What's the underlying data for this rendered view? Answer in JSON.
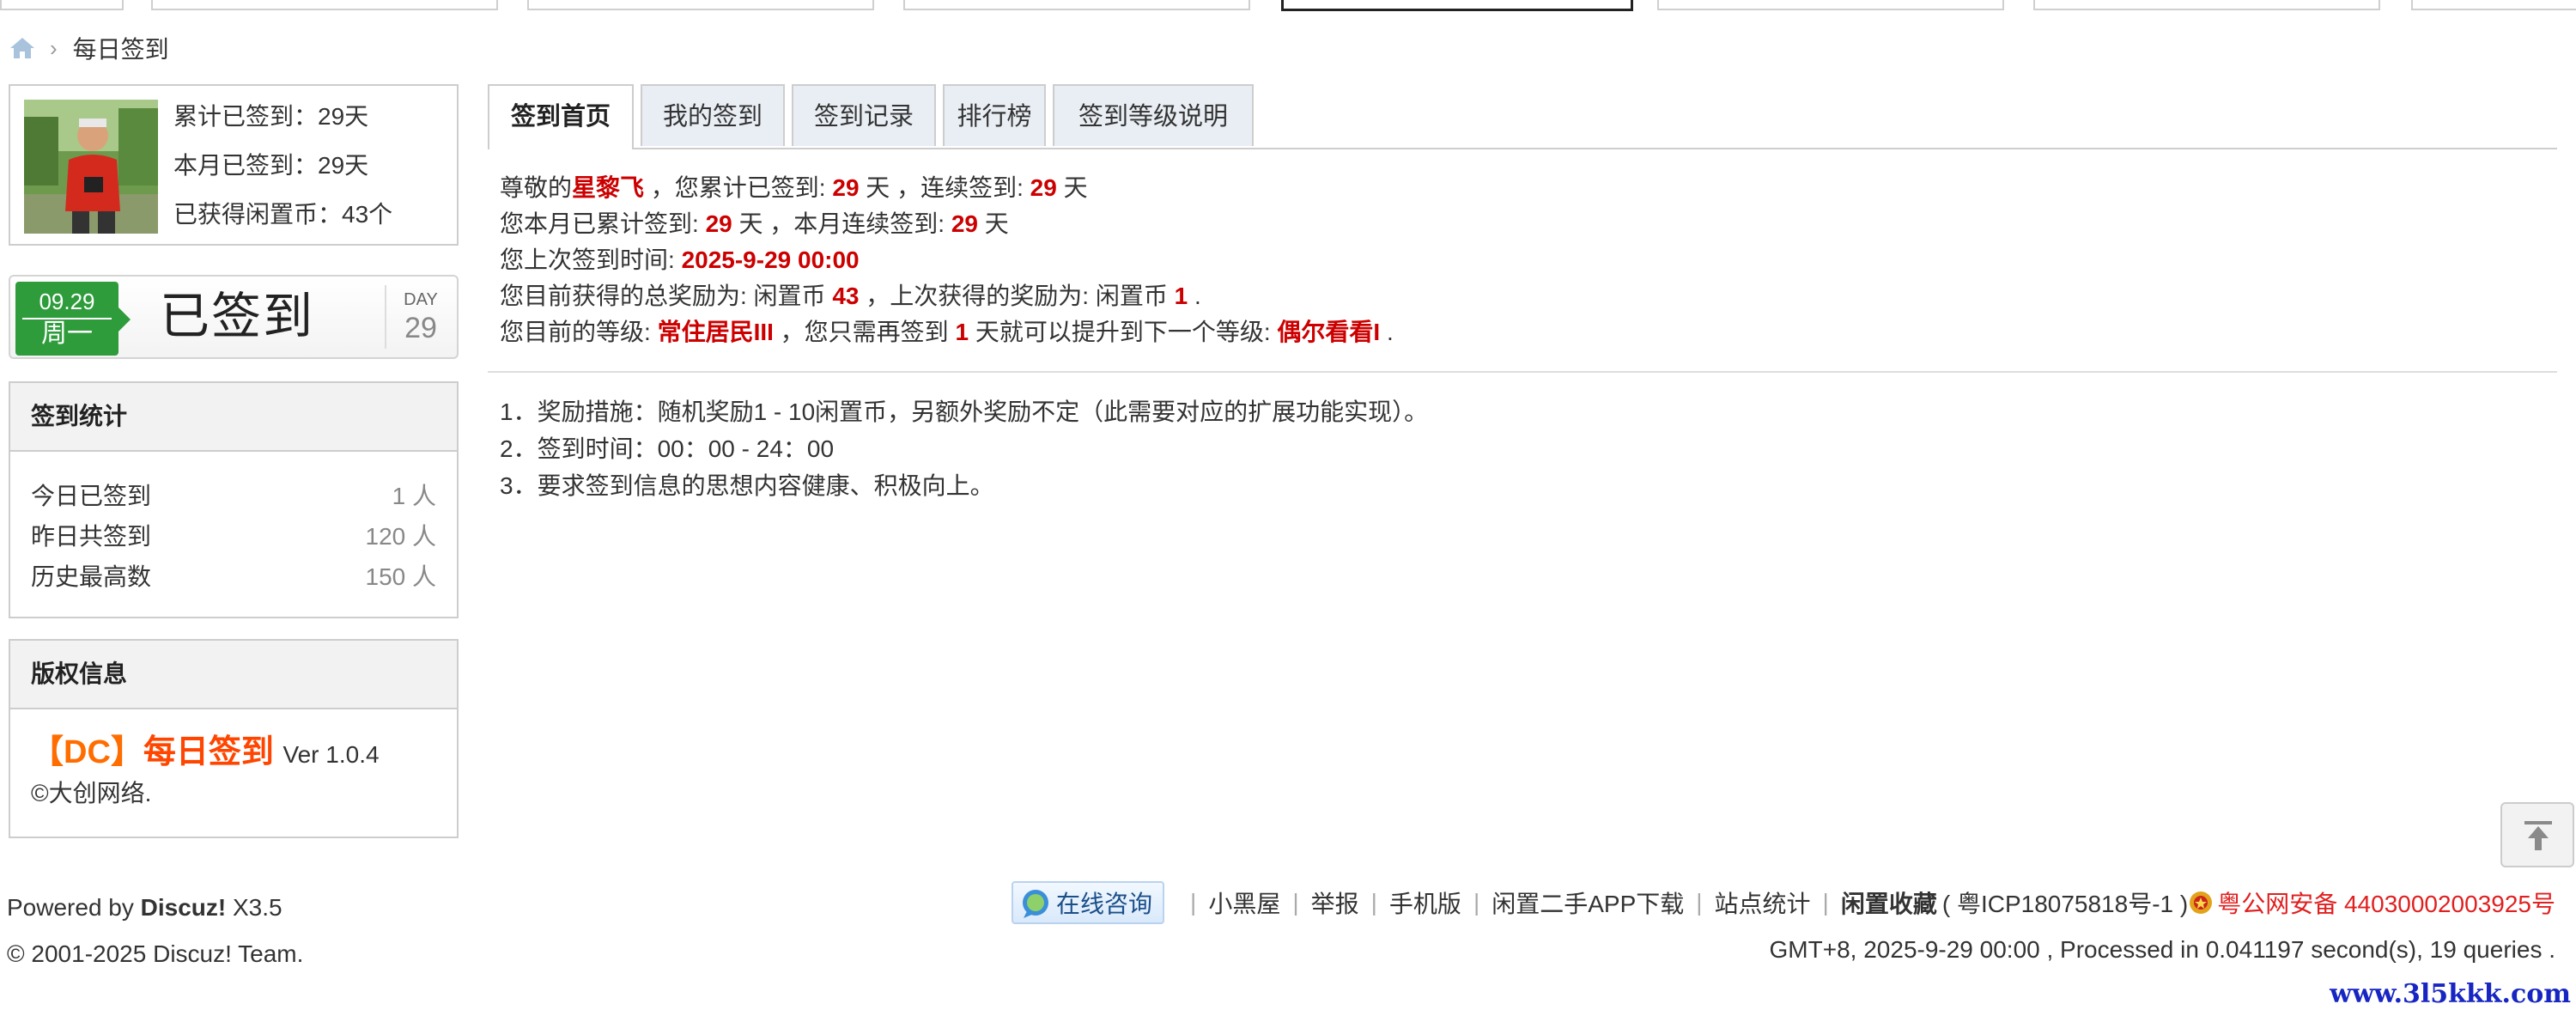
{
  "breadcrumb": {
    "home_icon": "home-icon",
    "current": "每日签到"
  },
  "user": {
    "total_signed": "累计已签到：29天",
    "month_signed": "本月已签到：29天",
    "coins": "已获得闲置币：43个"
  },
  "sign_card": {
    "date": "09.29",
    "weekday": "周一",
    "status": "已签到",
    "day_label": "DAY",
    "day_count": "29",
    "badge_color": "#2f9c3c"
  },
  "stats": {
    "title": "签到统计",
    "rows": [
      {
        "label": "今日已签到",
        "value": "1 人"
      },
      {
        "label": "昨日共签到",
        "value": "120 人"
      },
      {
        "label": "历史最高数",
        "value": "150 人"
      }
    ]
  },
  "copyright": {
    "title": "版权信息",
    "dc": "【DC】",
    "plugin": "每日签到",
    "version": "Ver 1.0.4",
    "company": "©大创网络."
  },
  "tabs": [
    "签到首页",
    "我的签到",
    "签到记录",
    "排行榜",
    "签到等级说明"
  ],
  "info": {
    "l1": {
      "p1": "尊敬的",
      "name": "星黎飞",
      "p2": " ，您累计已签到: ",
      "total": "29",
      "p3": " 天 ，连续签到: ",
      "streak": "29",
      "p4": " 天"
    },
    "l2": {
      "p1": "您本月已累计签到: ",
      "month": "29",
      "p2": " 天 ，本月连续签到: ",
      "month_streak": "29",
      "p3": " 天"
    },
    "l3": {
      "p1": "您上次签到时间: ",
      "time": "2025-9-29 00:00"
    },
    "l4": {
      "p1": "您目前获得的总奖励为: 闲置币 ",
      "total": "43",
      "p2": " ，上次获得的奖励为: 闲置币 ",
      "last": "1",
      "p3": " ."
    },
    "l5": {
      "p1": "您目前的等级: ",
      "level": "常住居民III",
      "p2": " ，您只需再签到 ",
      "need": "1",
      "p3": " 天就可以提升到下一个等级: ",
      "next": "偶尔看看I",
      "p4": " ."
    }
  },
  "rules": [
    "1．奖励措施：随机奖励1 - 10闲置币，另额外奖励不定（此需要对应的扩展功能实现）。",
    "2．签到时间：00：00 - 24：00",
    "3．要求签到信息的思想内容健康、积极向上。"
  ],
  "footer": {
    "powered_prefix": "Powered by ",
    "powered_name": "Discuz!",
    "powered_ver": " X3.5",
    "copyright": "© 2001-2025 Discuz! Team.",
    "consult": "在线咨询",
    "links": [
      "小黑屋",
      "举报",
      "手机版",
      "闲置二手APP下载",
      "站点统计"
    ],
    "brand": "闲置收藏",
    "icp": "( 粤ICP18075818号-1 )",
    "police": "粤公网安备 44030002003925号",
    "stats_line": "GMT+8, 2025-9-29 00:00 , Processed in 0.041197 second(s), 19 queries .",
    "watermark": "www.3l5kkk.com"
  },
  "accent_red": "#cc0000"
}
